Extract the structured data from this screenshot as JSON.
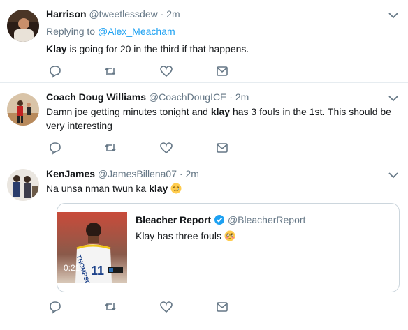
{
  "tweets": [
    {
      "name": "Harrison",
      "handle": "@tweetlessdew",
      "sep": "·",
      "time": "2m",
      "replying_prefix": "Replying to",
      "replying_to": "@Alex_Meacham",
      "text_bold": "Klay",
      "text_rest": " is going for 20 in the third if that happens."
    },
    {
      "name": "Coach Doug Williams",
      "handle": "@CoachDougICE",
      "sep": "·",
      "time": "2m",
      "text_pre": "Damn joe getting minutes tonight and ",
      "text_bold": "klay",
      "text_post": " has 3 fouls in the 1st. This should be",
      "text_line2": "very interesting"
    },
    {
      "name": "KenJames",
      "handle": "@JamesBillena07",
      "sep": "·",
      "time": "2m",
      "text_pre": "Na unsa nman twun ka ",
      "text_bold": "klay",
      "emoji": "crying-face",
      "quote": {
        "name": "Bleacher Report",
        "verified": true,
        "handle": "@BleacherReport",
        "text": "Klay has three fouls",
        "emoji": "flushed-face",
        "video_duration": "0:21",
        "jersey_name": "THOMPSON",
        "jersey_number": "11"
      }
    }
  ],
  "colors": {
    "link": "#1da1f2",
    "muted": "#657786",
    "border": "#e6ecf0",
    "icon": "#657786"
  }
}
